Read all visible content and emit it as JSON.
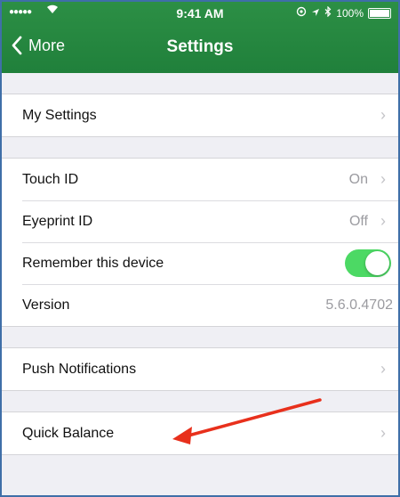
{
  "status_bar": {
    "signal": "●●●●●",
    "time": "9:41 AM",
    "battery_percent": "100%"
  },
  "nav": {
    "back_label": "More",
    "title": "Settings"
  },
  "groups": {
    "my_settings": {
      "label": "My Settings"
    },
    "touch_id": {
      "label": "Touch ID",
      "value": "On"
    },
    "eyeprint_id": {
      "label": "Eyeprint ID",
      "value": "Off"
    },
    "remember_device": {
      "label": "Remember this device",
      "toggle_on": true
    },
    "version": {
      "label": "Version",
      "value": "5.6.0.4702"
    },
    "push_notifications": {
      "label": "Push Notifications"
    },
    "quick_balance": {
      "label": "Quick Balance"
    }
  },
  "colors": {
    "header_green": "#20803b",
    "toggle_green": "#4cd964",
    "annotation_arrow": "#e8301c"
  },
  "icons": [
    "wifi-icon",
    "location-icon",
    "bluetooth-icon",
    "battery-icon",
    "chevron-left-icon",
    "chevron-right-icon"
  ]
}
